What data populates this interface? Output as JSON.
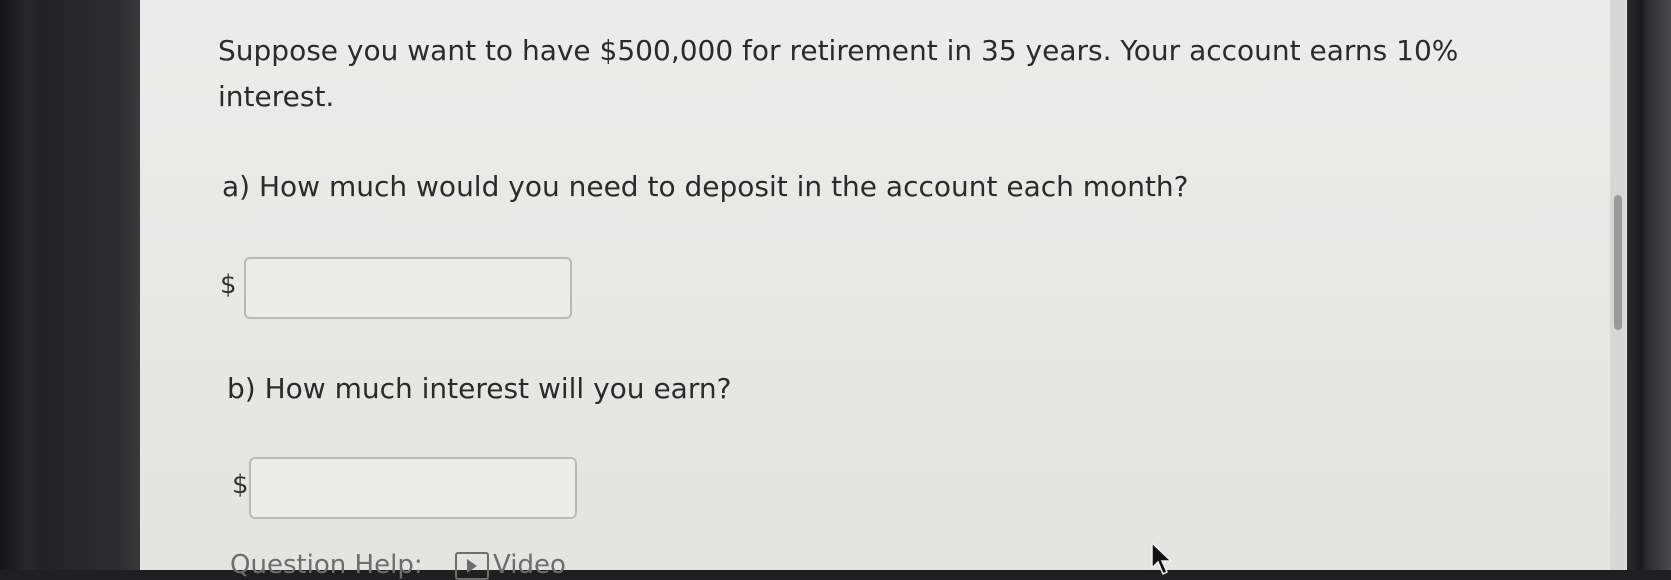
{
  "question": {
    "prompt": "Suppose you want to have $500,000 for retirement in 35 years. Your account earns 10% interest.",
    "part_a": {
      "label": "a) How much would you need to deposit in the account each month?",
      "currency_symbol": "$",
      "value": ""
    },
    "part_b": {
      "label": "b) How much interest will you earn?",
      "currency_symbol": "$",
      "value": ""
    }
  },
  "help": {
    "label": "Question Help:",
    "video_label": "Video",
    "video_icon": "video-play-icon"
  },
  "colors": {
    "page_background": "#e9e9e8",
    "text": "#2b2b2b",
    "input_border": "#b9b9b9"
  }
}
